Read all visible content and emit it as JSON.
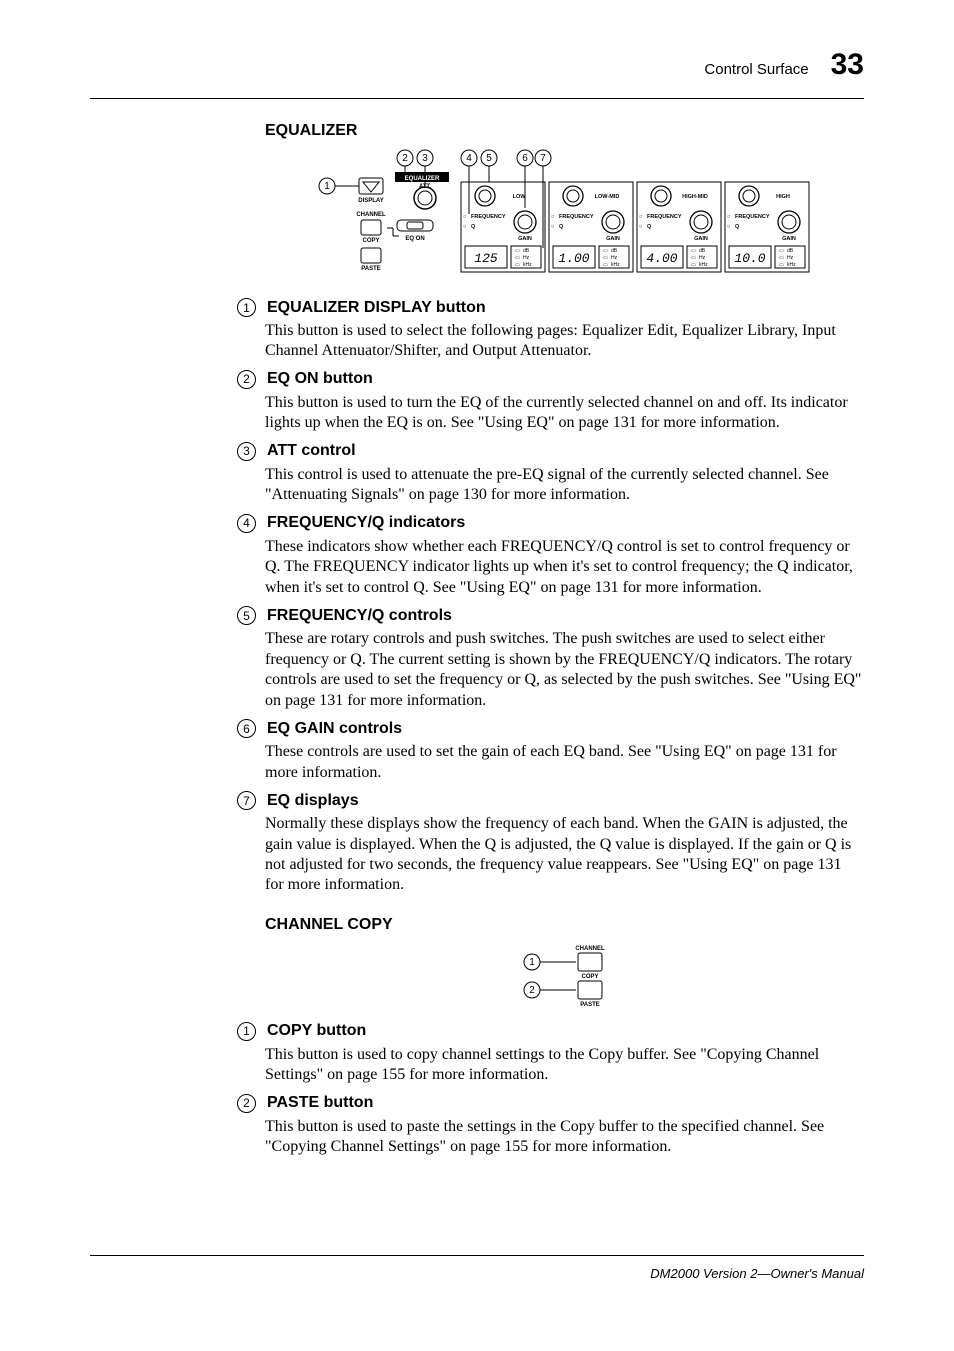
{
  "header": {
    "section": "Control Surface",
    "page": "33"
  },
  "footer": {
    "text": "DM2000 Version 2—Owner's Manual"
  },
  "equalizer": {
    "title": "EQUALIZER",
    "diagram": {
      "panel_label": "EQUALIZER",
      "display_label": "DISPLAY",
      "channel_label": "CHANNEL",
      "att_label": "ATT.",
      "copy_label": "COPY",
      "paste_label": "PASTE",
      "eq_on_label": "EQ ON",
      "frequency_label": "FREQUENCY",
      "q_label": "Q",
      "gain_label": "GAIN",
      "db_label": "dB",
      "hz_label": "Hz",
      "khz_label": "kHz",
      "bands": [
        {
          "name": "LOW",
          "display": "125"
        },
        {
          "name": "LOW-MID",
          "display": "1.00"
        },
        {
          "name": "HIGH-MID",
          "display": "4.00"
        },
        {
          "name": "HIGH",
          "display": "10.0"
        }
      ]
    },
    "items": [
      {
        "num": "1",
        "title": "EQUALIZER DISPLAY button",
        "body": "This button is used to select the following pages: Equalizer Edit, Equalizer Library, Input Channel Attenuator/Shifter, and Output Attenuator."
      },
      {
        "num": "2",
        "title": "EQ ON button",
        "body": "This button is used to turn the EQ of the currently selected channel on and off. Its indicator lights up when the EQ is on. See \"Using EQ\" on page 131 for more information."
      },
      {
        "num": "3",
        "title": "ATT control",
        "body": "This control is used to attenuate the pre-EQ signal of the currently selected channel. See \"Attenuating Signals\" on page 130 for more information."
      },
      {
        "num": "4",
        "title": "FREQUENCY/Q indicators",
        "body": "These indicators show whether each FREQUENCY/Q control is set to control frequency or Q. The FREQUENCY indicator lights up when it's set to control frequency; the Q indicator, when it's set to control Q. See \"Using EQ\" on page 131 for more information."
      },
      {
        "num": "5",
        "title": "FREQUENCY/Q controls",
        "body": "These are rotary controls and push switches. The push switches are used to select either frequency or Q. The current setting is shown by the FREQUENCY/Q indicators. The rotary controls are used to set the frequency or Q, as selected by the push switches. See \"Using EQ\" on page 131 for more information."
      },
      {
        "num": "6",
        "title": "EQ GAIN controls",
        "body": "These controls are used to set the gain of each EQ band. See \"Using EQ\" on page 131 for more information."
      },
      {
        "num": "7",
        "title": "EQ displays",
        "body": "Normally these displays show the frequency of each band. When the GAIN is adjusted, the gain value is displayed. When the Q is adjusted, the Q value is displayed. If the gain or Q is not adjusted for two seconds, the frequency value reappears. See \"Using EQ\" on page 131 for more information."
      }
    ]
  },
  "channel_copy": {
    "title": "CHANNEL COPY",
    "diagram": {
      "channel_label": "CHANNEL",
      "copy_label": "COPY",
      "paste_label": "PASTE"
    },
    "items": [
      {
        "num": "1",
        "title": "COPY button",
        "body": "This button is used to copy channel settings to the Copy buffer. See \"Copying Channel Settings\" on page 155 for more information."
      },
      {
        "num": "2",
        "title": "PASTE button",
        "body": "This button is used to paste the settings in the Copy buffer to the specified channel. See \"Copying Channel Settings\" on page 155 for more information."
      }
    ]
  }
}
